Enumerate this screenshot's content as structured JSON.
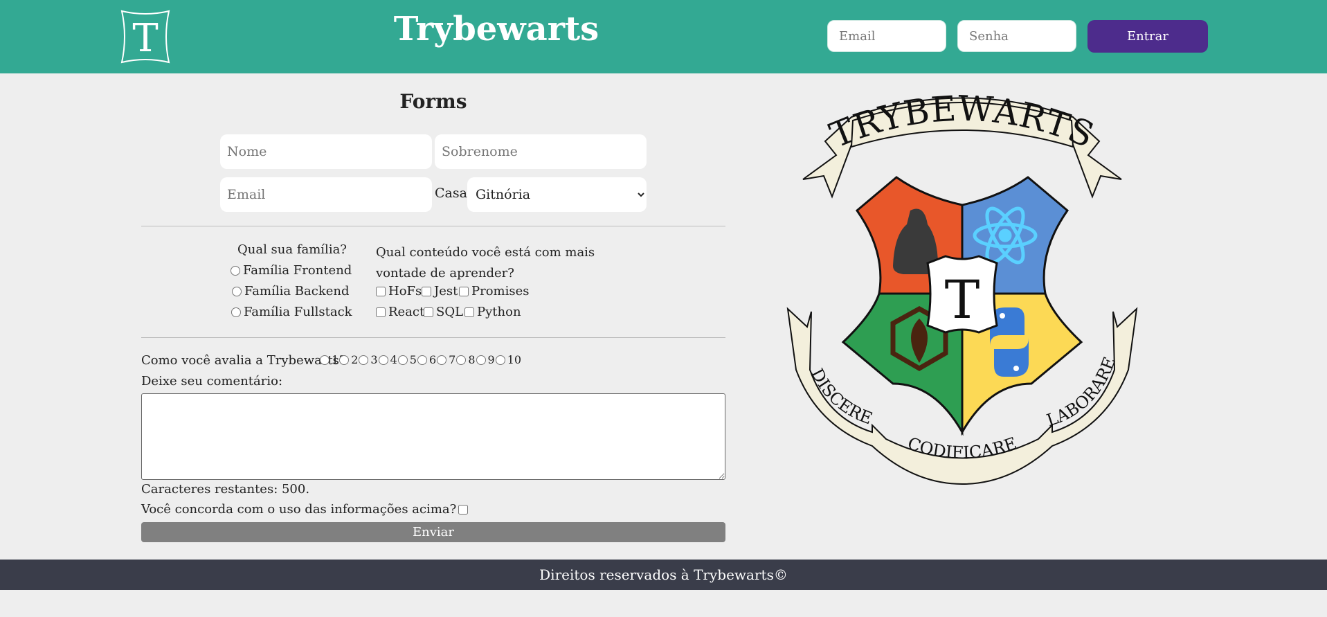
{
  "header": {
    "logo_letter": "T",
    "title": "Trybewarts",
    "email_placeholder": "Email",
    "password_placeholder": "Senha",
    "login_button": "Entrar"
  },
  "form": {
    "title": "Forms",
    "name_placeholder": "Nome",
    "surname_placeholder": "Sobrenome",
    "email_placeholder": "Email",
    "house_label": "Casa:",
    "house_selected": "Gitnória",
    "family": {
      "question": "Qual sua família?",
      "options": [
        "Família Frontend",
        "Família Backend",
        "Família Fullstack"
      ]
    },
    "content": {
      "question": "Qual conteúdo você está com mais vontade de aprender?",
      "options": [
        "HoFs",
        "Jest",
        "Promises",
        "React",
        "SQL",
        "Python"
      ]
    },
    "rating": {
      "question": "Como você avalia a Trybewarts?",
      "options": [
        "1",
        "2",
        "3",
        "4",
        "5",
        "6",
        "7",
        "8",
        "9",
        "10"
      ]
    },
    "comment_label": "Deixe seu comentário:",
    "chars_remaining": "Caracteres restantes: 500.",
    "agreement": "Você concorda com o uso das informações acima?",
    "submit": "Enviar"
  },
  "crest": {
    "top_banner": "TRYBEWARTS",
    "left_banner": "DISCERE",
    "bottom_banner": "CODIFICARE",
    "right_banner": "LABORARE",
    "shield_letter": "T"
  },
  "footer": {
    "text": "Direitos reservados à Trybewarts©"
  },
  "colors": {
    "header_bg": "#33a993",
    "login_button": "#4d2c8c",
    "footer_bg": "#3a3d4a",
    "submit_button": "#808080",
    "quarter_red": "#e8572a",
    "quarter_blue": "#5b8fd5",
    "quarter_green": "#2e9e52",
    "quarter_yellow": "#fcd955"
  }
}
